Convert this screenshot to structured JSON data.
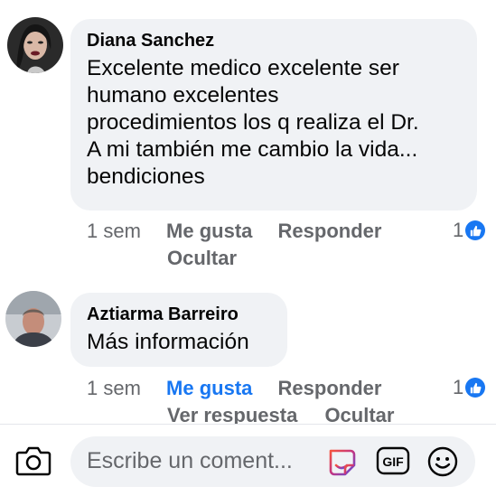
{
  "comments": [
    {
      "author": "Diana Sanchez",
      "text": "Excelente medico excelente ser\nhumano excelentes\nprocedimientos los q realiza el Dr.\nA mi también me cambio la vida...\nbendiciones",
      "time": "1 sem",
      "like_label": "Me gusta",
      "reply_label": "Responder",
      "hide_label": "Ocultar",
      "reaction_count": "1",
      "liked": false
    },
    {
      "author": "Aztiarma Barreiro",
      "text": "Más información",
      "time": "1 sem",
      "like_label": "Me gusta",
      "reply_label": "Responder",
      "view_reply_label": "Ver respuesta",
      "hide_label": "Ocultar",
      "reaction_count": "1",
      "liked": true
    }
  ],
  "composer": {
    "placeholder": "Escribe un coment...",
    "gif_label": "GIF",
    "icons": [
      "camera-icon",
      "avatar-sticker-icon",
      "gif-icon",
      "emoji-icon"
    ]
  },
  "colors": {
    "accent": "#1877f2",
    "bubble": "#f0f2f5",
    "secondary_text": "#65676b"
  }
}
